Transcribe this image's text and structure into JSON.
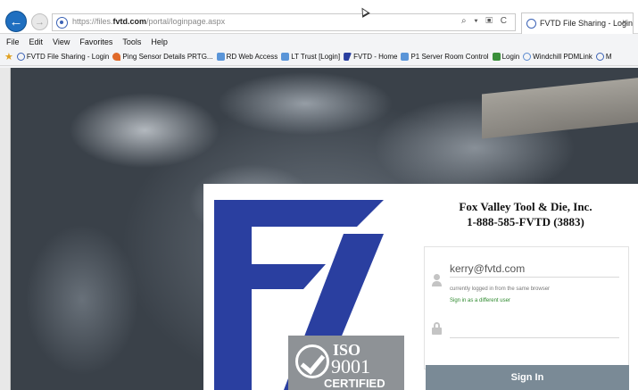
{
  "browser": {
    "url_prefix": "https://files.",
    "url_host": "fvtd.com",
    "url_path": "/portal/loginpage.aspx",
    "address_controls": "⌕ ▾ ▣ C",
    "tab_title": "FVTD File Sharing - Login",
    "tab_close": "×",
    "back_glyph": "←",
    "forward_glyph": "→"
  },
  "menubar": {
    "items": [
      "File",
      "Edit",
      "View",
      "Favorites",
      "Tools",
      "Help"
    ]
  },
  "favorites": {
    "star_glyph": "★",
    "items": [
      {
        "label": "FVTD File Sharing - Login",
        "icon": "globe-icon"
      },
      {
        "label": "Ping Sensor Details PRTG...",
        "icon": "ping-icon"
      },
      {
        "label": "RD Web Access",
        "icon": "ie-page-icon"
      },
      {
        "label": "LT Trust [Login]",
        "icon": "ie-page-icon"
      },
      {
        "label": "FVTD - Home",
        "icon": "fvtd-icon"
      },
      {
        "label": "P1 Server Room Control",
        "icon": "ie-page-icon"
      },
      {
        "label": "Login",
        "icon": "login-icon"
      },
      {
        "label": "Windchill PDMLink",
        "icon": "pdm-icon"
      },
      {
        "label": "M",
        "icon": "globe-icon"
      }
    ]
  },
  "login": {
    "company_name": "Fox Valley Tool & Die, Inc.",
    "company_phone": "1-888-585-FVTD (3883)",
    "username_value": "kerry@fvtd.com",
    "logged_in_note": "currently logged in from the same browser",
    "switch_user_link": "Sign in as a different user",
    "password_value": "",
    "signin_label": "Sign In"
  },
  "iso_badge": {
    "label": "ISO",
    "number": "9001",
    "certified": "CERTIFIED"
  },
  "colors": {
    "logo_blue": "#2a3fa0",
    "button_bg": "#7a8a96",
    "link_green": "#2f8a2f",
    "chrome_blue": "#1f6fc0"
  }
}
